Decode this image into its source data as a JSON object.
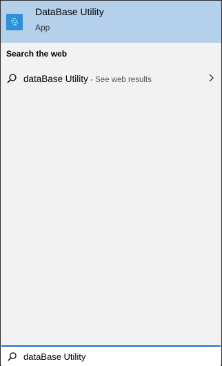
{
  "best_match": {
    "app_name": "DataBase Utility",
    "app_type": "App",
    "icon": "database-app-icon"
  },
  "web_section": {
    "header": "Search the web",
    "query": "dataBase Utility",
    "suffix": " - See web results"
  },
  "search_box": {
    "value": "dataBase Utility"
  },
  "colors": {
    "highlight": "#b5d0ea",
    "panel_bg": "#f2f2f2",
    "accent": "#1a73c8"
  }
}
